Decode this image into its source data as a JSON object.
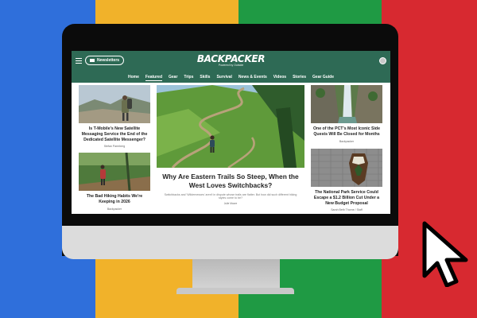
{
  "header": {
    "newsletter_label": "Newsletters",
    "logo": "BACKPACKER",
    "logo_sub": "Powered by Outside"
  },
  "nav": {
    "items": [
      "Home",
      "Featured",
      "Gear",
      "Trips",
      "Skills",
      "Survival",
      "News & Events",
      "Videos",
      "Stories",
      "Gear Guide"
    ],
    "active": "Featured"
  },
  "articles": {
    "left1": {
      "title": "Is T-Mobile's New Satellite Messaging Service the End of the Dedicated Satellite Messenger?",
      "author": "Stefan Parmberg"
    },
    "left2": {
      "title": "The Bad Hiking Habits We're Keeping in 2026",
      "author": "Backpacker"
    },
    "main": {
      "title": "Why Are Eastern Trails So Steep, When the West Loves Switchbacks?",
      "description": "Switchbacks and 'Wildernesses' aren't in dispute whose trails are flatter. But how did such different hiking styles come to be?",
      "author": "Julie Moore"
    },
    "right1": {
      "title": "One of the PCT's Most Iconic Side Quests Will Be Closed for Months",
      "author": "Backpacker"
    },
    "right2": {
      "title": "The National Park Service Could Escape a $1.2 Billion Cut Under a New Budget Proposal",
      "author": "Sarah Beth Thorne / Staff"
    }
  },
  "colors": {
    "header_bg": "#2e6a55",
    "stripe_blue": "#2f6fdb",
    "stripe_yellow": "#f1b22a",
    "stripe_green": "#1f9a44",
    "stripe_red": "#d72930"
  },
  "icons": [
    "menu-icon",
    "mail-icon",
    "avatar-icon",
    "cursor-arrow-icon"
  ]
}
